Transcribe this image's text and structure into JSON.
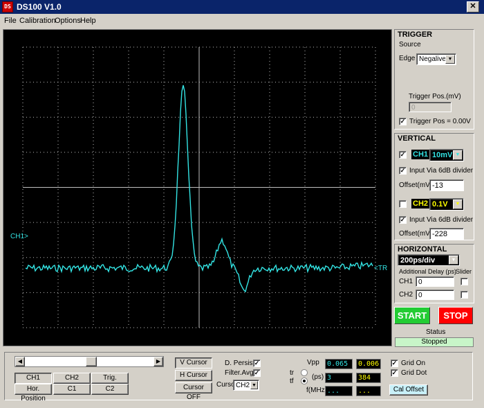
{
  "window": {
    "title": "DS100 V1.0",
    "icon_text": "DS",
    "close_label": "✕"
  },
  "menu": [
    "File",
    "Calibration",
    "Options",
    "Help"
  ],
  "scope": {
    "ch1_marker": "CH1>",
    "trigger_marker": "<TR",
    "trace_color": "#33e5e5",
    "grid_color": "#c0c0c0"
  },
  "trigger": {
    "title": "TRIGGER",
    "source_label": "Source",
    "edge_label": "Edge",
    "edge_value": "Negalive",
    "pos_label": "Trigger Pos.(mV)",
    "pos_value": "0",
    "pos_zero_label": "Trigger Pos = 0.00V",
    "pos_zero_checked": "✓"
  },
  "vertical": {
    "title": "VERTICAL",
    "ch1": {
      "name": "CH1",
      "scale": "10mV",
      "enabled": "✓",
      "divider_label": "Input Via 6dB divider",
      "divider_checked": "✓",
      "offset_label": "Offset(mV)",
      "offset_value": "-13",
      "color": "#33e5e5"
    },
    "ch2": {
      "name": "CH2",
      "scale": "0.1V",
      "enabled": "",
      "divider_label": "Input Via 6dB divider",
      "divider_checked": "✓",
      "offset_label": "Offset(mV)",
      "offset_value": "-228",
      "color": "#ffff00"
    }
  },
  "horizontal": {
    "title": "HORIZONTAL",
    "timebase": "200ps/div",
    "delay_label": "Additional Delay (ps)",
    "slider_label": "Slider",
    "ch1_label": "CH1",
    "ch1_value": "0",
    "ch2_label": "CH2",
    "ch2_value": "0"
  },
  "controls": {
    "start_label": "START",
    "stop_label": "STOP",
    "status_label": "Status",
    "status_value": "Stopped"
  },
  "bottom": {
    "position_buttons": [
      "CH1 Position",
      "CH2 Position",
      "Trig. Position",
      "Hor. Position",
      "C1",
      "C2"
    ],
    "v_cursor": "V Cursor",
    "h_cursor": "H Cursor",
    "cursor_off": "Cursor OFF",
    "d_persist": "D. Persist",
    "filter_avg": "Filter.Avg",
    "cursor_label": "Cursor",
    "cursor_value": "CH2",
    "vpp_label": "Vpp",
    "vpp_ch1": "0.065",
    "vpp_ch2": "0.006",
    "tr_label": "tr",
    "tf_label": "tf",
    "ps_label": "(ps)",
    "ps_ch1": "3",
    "ps_ch2": "384",
    "fmhz_label": "f(MHz)",
    "fmhz_ch1": "...",
    "fmhz_ch2": "...",
    "grid_on": "Grid On",
    "grid_dot": "Grid Dot",
    "cal_offset": "Cal Offset",
    "check_mark": "✓"
  }
}
